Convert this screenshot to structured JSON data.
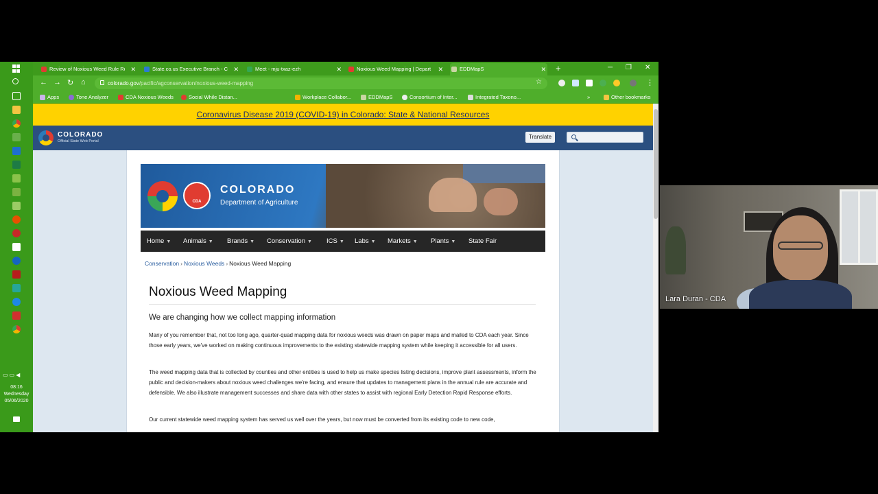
{
  "browser": {
    "tabs": [
      {
        "title": "Review of Noxious Weed Rule Re",
        "color": "#e03c31"
      },
      {
        "title": "State.co.us Executive Branch - Co",
        "color": "#2b7bd3"
      },
      {
        "title": "Meet - mju-txaz-ezh",
        "color": "#34a853"
      },
      {
        "title": "Noxious Weed Mapping | Depart",
        "color": "#e03c31"
      },
      {
        "title": "EDDMapS",
        "color": "#c9d6a3"
      }
    ],
    "url_host": "colorado.gov",
    "url_path": "/pacific/agconservation/noxious-weed-mapping",
    "bookmarks": [
      {
        "label": "Apps",
        "color": "#c9b5e8"
      },
      {
        "label": "Tone Analyzer",
        "color": "#8b6bd6"
      },
      {
        "label": "CDA Noxious Weeds",
        "color": "#e03c31"
      },
      {
        "label": "Social While Distan...",
        "color": "#e03c31"
      },
      {
        "label": "Workplace Collabor...",
        "color": "#f4b400"
      },
      {
        "label": "EDDMapS",
        "color": "#c9d6a3"
      },
      {
        "label": "Consortium of Inter...",
        "color": "#eeeeee"
      },
      {
        "label": "Integrated Taxono...",
        "color": "#dddddd"
      }
    ],
    "other_bookmarks": "Other bookmarks"
  },
  "site": {
    "covid_banner": "Coronavirus Disease 2019 (COVID-19) in Colorado: State & National Resources",
    "portal_name": "COLORADO",
    "portal_sub": "Official State Web Portal",
    "translate_label": "Translate",
    "search_placeholder": "",
    "hero_name": "COLORADO",
    "hero_sub": "Department of Agriculture",
    "hero_badge": "CDA",
    "nav": [
      {
        "label": "Home",
        "dropdown": true
      },
      {
        "label": "Animals",
        "dropdown": true
      },
      {
        "label": "Brands",
        "dropdown": true
      },
      {
        "label": "Conservation",
        "dropdown": true
      },
      {
        "label": "ICS",
        "dropdown": true
      },
      {
        "label": "Labs",
        "dropdown": true
      },
      {
        "label": "Markets",
        "dropdown": true
      },
      {
        "label": "Plants",
        "dropdown": true
      },
      {
        "label": "State Fair",
        "dropdown": false
      }
    ],
    "breadcrumb": [
      "Conservation",
      "Noxious Weeds",
      "Noxious Weed Mapping"
    ],
    "page_title": "Noxious Weed Mapping",
    "subhead": "We are changing how we collect mapping information",
    "paragraphs": [
      "Many of you remember that, not too long ago, quarter-quad mapping data for noxious weeds was drawn on paper maps and mailed to CDA each year.  Since those early years, we've worked on making continuous improvements to the existing statewide mapping system while keeping it accessible for all users.",
      "The weed mapping data that is collected by counties and other entities is used to help us make species listing decisions, improve plant assessments, inform the public and decision-makers about noxious weed challenges we're facing, and ensure that updates to management plans in the annual rule are accurate and defensible.  We also illustrate management successes and share data with other states to assist with regional Early Detection Rapid Response efforts.",
      "Our current statewide weed mapping system has served us well over the years, but now must be converted from its existing code to new code,"
    ]
  },
  "taskbar": {
    "time": "08:16",
    "day": "Wednesday",
    "date": "05/06/2020"
  },
  "webcam": {
    "name": "Lara Duran - CDA"
  }
}
